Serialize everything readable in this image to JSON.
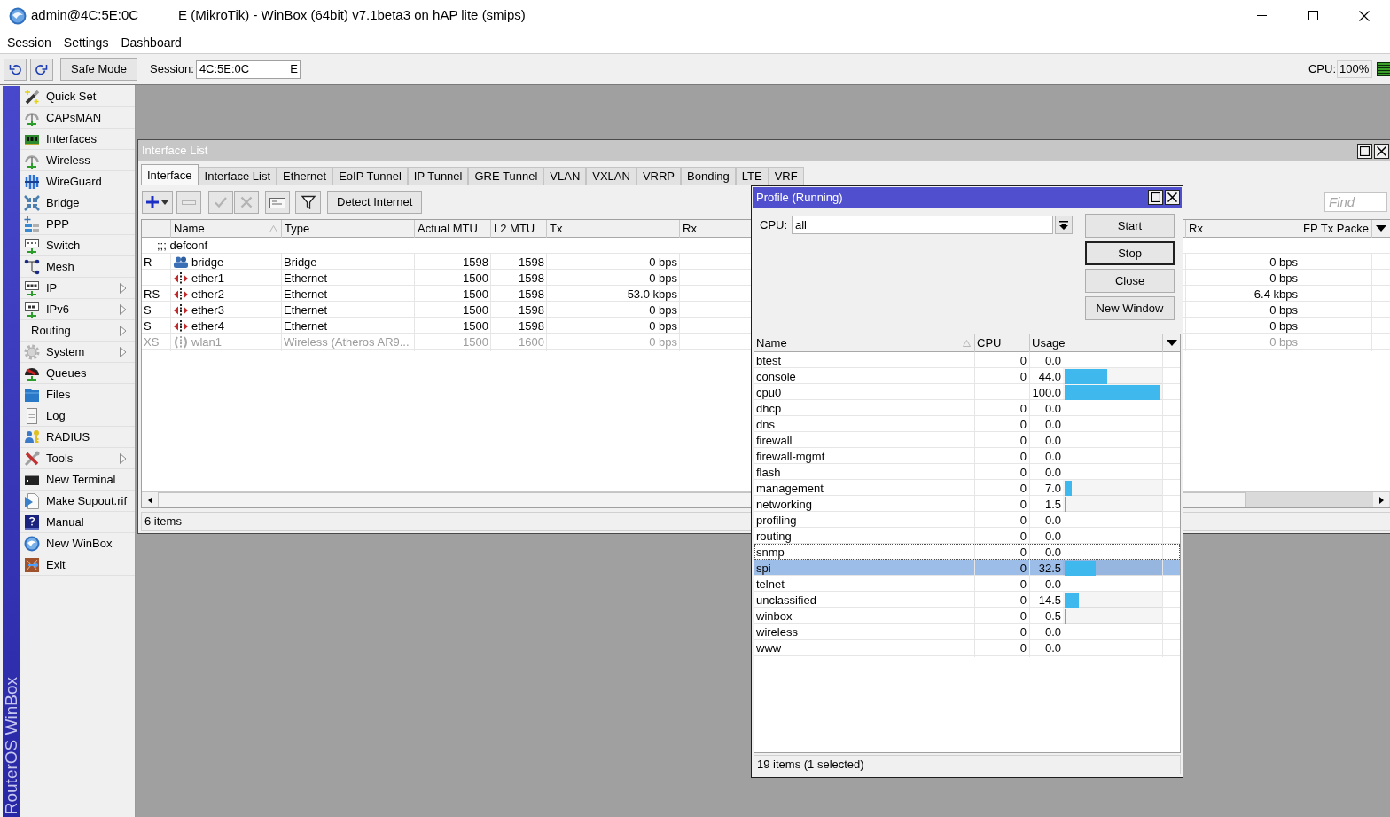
{
  "window": {
    "title": "admin@4C:5E:0C",
    "title_rest": "E (MikroTik) - WinBox (64bit) v7.1beta3 on hAP lite (smips)"
  },
  "menu": [
    "Session",
    "Settings",
    "Dashboard"
  ],
  "toolbar": {
    "safe_mode": "Safe Mode",
    "session_label": "Session:",
    "session_value": "4C:5E:0C",
    "session_value_end": "E",
    "cpu_label": "CPU:",
    "cpu_value": "100%"
  },
  "sidebar": {
    "brand": "RouterOS WinBox",
    "items": [
      {
        "label": "Quick Set",
        "submenu": false
      },
      {
        "label": "CAPsMAN",
        "submenu": false
      },
      {
        "label": "Interfaces",
        "submenu": false
      },
      {
        "label": "Wireless",
        "submenu": false
      },
      {
        "label": "WireGuard",
        "submenu": false
      },
      {
        "label": "Bridge",
        "submenu": false
      },
      {
        "label": "PPP",
        "submenu": false
      },
      {
        "label": "Switch",
        "submenu": false
      },
      {
        "label": "Mesh",
        "submenu": false
      },
      {
        "label": "IP",
        "submenu": true
      },
      {
        "label": "IPv6",
        "submenu": true
      },
      {
        "label": "Routing",
        "submenu": true
      },
      {
        "label": "System",
        "submenu": true
      },
      {
        "label": "Queues",
        "submenu": false
      },
      {
        "label": "Files",
        "submenu": false
      },
      {
        "label": "Log",
        "submenu": false
      },
      {
        "label": "RADIUS",
        "submenu": false
      },
      {
        "label": "Tools",
        "submenu": true
      },
      {
        "label": "New Terminal",
        "submenu": false
      },
      {
        "label": "Make Supout.rif",
        "submenu": false
      },
      {
        "label": "Manual",
        "submenu": false
      },
      {
        "label": "New WinBox",
        "submenu": false
      },
      {
        "label": "Exit",
        "submenu": false
      }
    ]
  },
  "interface_window": {
    "title": "Interface List",
    "active": false,
    "tabs": [
      {
        "label": "Interface",
        "selected": true
      },
      {
        "label": "Interface List",
        "selected": false
      },
      {
        "label": "Ethernet",
        "selected": false
      },
      {
        "label": "EoIP Tunnel",
        "selected": false
      },
      {
        "label": "IP Tunnel",
        "selected": false
      },
      {
        "label": "GRE Tunnel",
        "selected": false
      },
      {
        "label": "VLAN",
        "selected": false
      },
      {
        "label": "VXLAN",
        "selected": false
      },
      {
        "label": "VRRP",
        "selected": false
      },
      {
        "label": "Bonding",
        "selected": false
      },
      {
        "label": "LTE",
        "selected": false
      },
      {
        "label": "VRF",
        "selected": false
      }
    ],
    "tools": [
      {
        "kind": "add",
        "disabled": false
      },
      {
        "kind": "remove",
        "disabled": true
      },
      {
        "kind": "enable",
        "disabled": true
      },
      {
        "kind": "disable",
        "disabled": true
      },
      {
        "kind": "comment",
        "disabled": false
      },
      {
        "kind": "filter",
        "disabled": false
      },
      {
        "kind": "text",
        "label": "Detect Internet",
        "disabled": false
      }
    ],
    "find": {
      "placeholder": "Find"
    },
    "table": {
      "columns": [
        {
          "label": "Name",
          "sorted": true
        },
        {
          "label": "Type",
          "sorted": false
        },
        {
          "label": "Actual MTU",
          "sorted": false
        },
        {
          "label": "L2 MTU",
          "sorted": false
        },
        {
          "label": "Tx",
          "sorted": false
        },
        {
          "label": "Rx",
          "sorted": false
        },
        {
          "label": "Rx",
          "sorted": false
        },
        {
          "label": "FP Tx Packe",
          "sorted": false
        }
      ],
      "comment": ";;; defconf",
      "rows": [
        {
          "flags": "R",
          "name": "bridge",
          "kind": "bridge",
          "type": "Bridge",
          "actual_mtu": "1598",
          "l2_mtu": "1598",
          "tx": "0 bps",
          "rx": "0 bps",
          "disabled": false,
          "selected": false
        },
        {
          "name": "ether1",
          "kind": "ethernet",
          "type": "Ethernet",
          "actual_mtu": "1500",
          "l2_mtu": "1598",
          "tx": "0 bps",
          "rx": "0 bps",
          "disabled": false,
          "selected": false
        },
        {
          "flags": "RS",
          "name": "ether2",
          "kind": "ethernet",
          "type": "Ethernet",
          "actual_mtu": "1500",
          "l2_mtu": "1598",
          "tx": "53.0 kbps",
          "rx": "6.4 kbps",
          "disabled": false,
          "selected": false
        },
        {
          "flags": "S",
          "name": "ether3",
          "kind": "ethernet",
          "type": "Ethernet",
          "actual_mtu": "1500",
          "l2_mtu": "1598",
          "tx": "0 bps",
          "rx": "0 bps",
          "disabled": false,
          "selected": false
        },
        {
          "flags": "S",
          "name": "ether4",
          "kind": "ethernet",
          "type": "Ethernet",
          "actual_mtu": "1500",
          "l2_mtu": "1598",
          "tx": "0 bps",
          "rx": "0 bps",
          "disabled": false,
          "selected": false
        },
        {
          "flags": "XS",
          "name": "wlan1",
          "kind": "wireless",
          "type": "Wireless (Atheros AR9...",
          "actual_mtu": "1500",
          "l2_mtu": "1600",
          "tx": "0 bps",
          "rx": "0 bps",
          "disabled": true,
          "selected": false
        }
      ]
    },
    "status": "6 items"
  },
  "profile_window": {
    "title": "Profile (Running)",
    "active": true,
    "cpu": {
      "label": "CPU:",
      "value": "all"
    },
    "buttons": [
      {
        "label": "Start",
        "default": false
      },
      {
        "label": "Stop",
        "default": true
      },
      {
        "label": "Close",
        "default": false
      },
      {
        "label": "New Window",
        "default": false
      }
    ],
    "table": {
      "columns": [
        {
          "label": "Name",
          "sorted": true
        },
        {
          "label": "CPU",
          "sorted": false
        },
        {
          "label": "Usage",
          "sorted": false
        }
      ],
      "rows": [
        {
          "name": "btest",
          "cpu": "0",
          "usage": "0.0",
          "selected": false,
          "focused": false
        },
        {
          "name": "console",
          "cpu": "0",
          "usage": "44.0",
          "level": 0.44,
          "selected": false,
          "focused": false
        },
        {
          "name": "cpu0",
          "usage": "100.0",
          "level": 1,
          "selected": false,
          "focused": false
        },
        {
          "name": "dhcp",
          "cpu": "0",
          "usage": "0.0",
          "selected": false,
          "focused": false
        },
        {
          "name": "dns",
          "cpu": "0",
          "usage": "0.0",
          "selected": false,
          "focused": false
        },
        {
          "name": "firewall",
          "cpu": "0",
          "usage": "0.0",
          "selected": false,
          "focused": false
        },
        {
          "name": "firewall-mgmt",
          "cpu": "0",
          "usage": "0.0",
          "selected": false,
          "focused": false
        },
        {
          "name": "flash",
          "cpu": "0",
          "usage": "0.0",
          "selected": false,
          "focused": false
        },
        {
          "name": "management",
          "cpu": "0",
          "usage": "7.0",
          "level": 0.07,
          "selected": false,
          "focused": false
        },
        {
          "name": "networking",
          "cpu": "0",
          "usage": "1.5",
          "level": 0.015,
          "selected": false,
          "focused": false
        },
        {
          "name": "profiling",
          "cpu": "0",
          "usage": "0.0",
          "selected": false,
          "focused": false
        },
        {
          "name": "routing",
          "cpu": "0",
          "usage": "0.0",
          "selected": false,
          "focused": false
        },
        {
          "name": "snmp",
          "cpu": "0",
          "usage": "0.0",
          "selected": false,
          "focused": true
        },
        {
          "name": "spi",
          "cpu": "0",
          "usage": "32.5",
          "level": 0.325,
          "selected": true,
          "focused": false
        },
        {
          "name": "telnet",
          "cpu": "0",
          "usage": "0.0",
          "selected": false,
          "focused": false
        },
        {
          "name": "unclassified",
          "cpu": "0",
          "usage": "14.5",
          "level": 0.145,
          "selected": false,
          "focused": false
        },
        {
          "name": "winbox",
          "cpu": "0",
          "usage": "0.5",
          "level": 0.005,
          "selected": false,
          "focused": false
        },
        {
          "name": "wireless",
          "cpu": "0",
          "usage": "0.0",
          "selected": false,
          "focused": false
        },
        {
          "name": "www",
          "cpu": "0",
          "usage": "0.0",
          "selected": false,
          "focused": false
        }
      ]
    },
    "status": "19 items (1 selected)"
  }
}
